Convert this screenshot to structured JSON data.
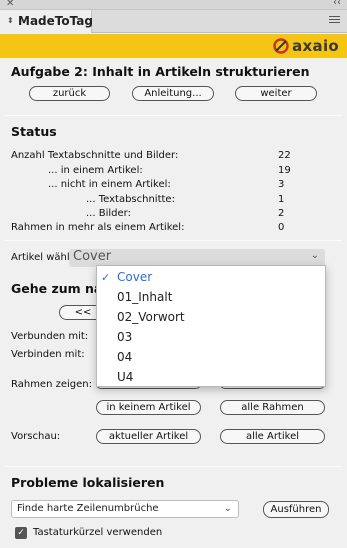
{
  "panel": {
    "tab_title": "MadeToTag"
  },
  "brand": {
    "logo_text": "axaio",
    "color": "#f5c514"
  },
  "task": {
    "heading": "Aufgabe 2: Inhalt in Artikeln strukturieren",
    "buttons": {
      "back": "zurück",
      "guide": "Anleitung...",
      "next": "weiter"
    }
  },
  "status": {
    "heading": "Status",
    "rows": [
      {
        "label": "Anzahl Textabschnitte und Bilder:",
        "value": "22"
      },
      {
        "label": "... in einem Artikel:",
        "value": "19"
      },
      {
        "label": "... nicht in einem Artikel:",
        "value": "3"
      },
      {
        "label": "... Textabschnitte:",
        "value": "1"
      },
      {
        "label": "... Bilder:",
        "value": "2"
      },
      {
        "label": "Rahmen in mehr als einem Artikel:",
        "value": "0"
      }
    ]
  },
  "article": {
    "label": "Artikel wählen:",
    "selected": "Cover",
    "options": [
      "Cover",
      "01_Inhalt",
      "02_Vorwort",
      "03",
      "04",
      "U4"
    ]
  },
  "goto": {
    "heading": "Gehe zum näc",
    "prev": "<<"
  },
  "links": {
    "connected": "Verbunden mit:",
    "connect": "Verbinden mit:"
  },
  "frames": {
    "label": "Rahmen zeigen:",
    "none": "in keinem Artikel",
    "all": "alle Rahmen"
  },
  "preview": {
    "label": "Vorschau:",
    "current": "aktueller Artikel",
    "all": "alle Artikel"
  },
  "problems": {
    "heading": "Probleme lokalisieren",
    "select_value": "Finde harte Zeilenumbrüche",
    "run": "Ausführen",
    "shortcut_label": "Tastaturkürzel verwenden",
    "shortcut_checked": true
  },
  "colors": {
    "selection": "#2a6fd6"
  }
}
